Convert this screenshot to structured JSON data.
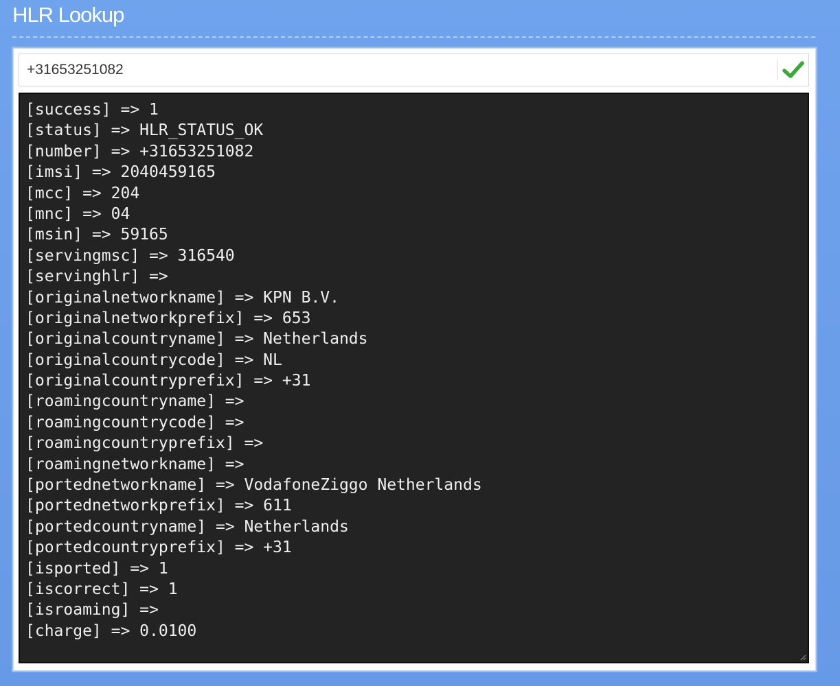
{
  "header": {
    "title": "HLR Lookup"
  },
  "lookup": {
    "phone_value": "+31653251082",
    "submit_icon": "checkmark-icon",
    "accent_color": "#3aa83a"
  },
  "output": {
    "background": "#232323",
    "lines": [
      "[success] => 1",
      "[status] => HLR_STATUS_OK",
      "[number] => +31653251082",
      "[imsi] => 2040459165",
      "[mcc] => 204",
      "[mnc] => 04",
      "[msin] => 59165",
      "[servingmsc] => 316540",
      "[servinghlr] =>",
      "[originalnetworkname] => KPN B.V.",
      "[originalnetworkprefix] => 653",
      "[originalcountryname] => Netherlands",
      "[originalcountrycode] => NL",
      "[originalcountryprefix] => +31",
      "[roamingcountryname] =>",
      "[roamingcountrycode] =>",
      "[roamingcountryprefix] =>",
      "[roamingnetworkname] =>",
      "[portednetworkname] => VodafoneZiggo Netherlands",
      "[portednetworkprefix] => 611",
      "[portedcountryname] => Netherlands",
      "[portedcountryprefix] => +31",
      "[isported] => 1",
      "[iscorrect] => 1",
      "[isroaming] =>",
      "[charge] => 0.0100"
    ]
  }
}
